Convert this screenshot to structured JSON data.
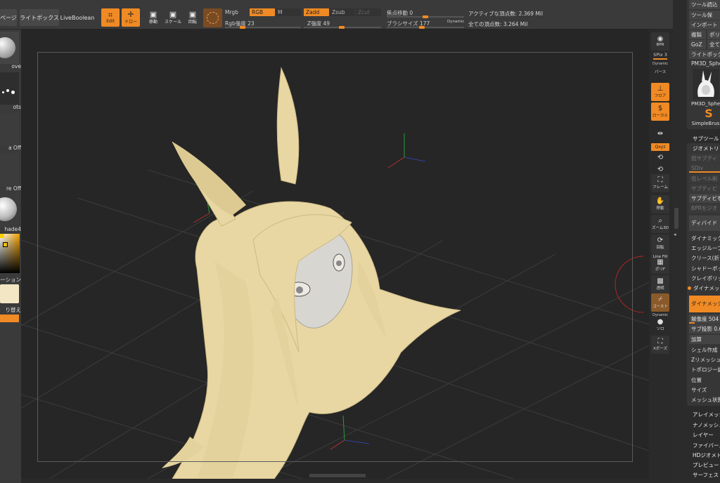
{
  "top_bar": {
    "page_label": "ページ",
    "lightbox_label": "ライトボックス",
    "liveboolean_label": "LiveBoolean",
    "edit_label": "Edit",
    "draw_label": "ドロー",
    "move_label": "移動",
    "scale_label": "スケール",
    "rotate_label": "回転",
    "mrgb_label": "Mrgb",
    "rgb_label": "RGB",
    "m_label": "M",
    "rgb_intensity_label": "Rgb強度",
    "rgb_intensity_value": "23",
    "zadd_label": "Zadd",
    "zsub_label": "Zsub",
    "zcut_label": "Zcut",
    "z_intensity_label": "Z強度",
    "z_intensity_value": "49",
    "focal_shift_label": "焦点移動",
    "focal_shift_value": "0",
    "brush_size_label": "ブラシサイズ",
    "brush_size_value": "177",
    "dynamic_label": "Dynamic",
    "active_points": "アクティブな頂点数: 2.369 Mil",
    "total_points": "全ての頂点数: 3.264 Mil",
    "rgb_intensity_level": 0.23,
    "z_intensity_level": 0.49,
    "focal_level": 0.5,
    "brush_level": 0.45
  },
  "left_tray": {
    "brush_label": "ove",
    "stroke_label": "ots",
    "alpha_label": "a Off",
    "texture_label": "re Off",
    "material_label": "hade4",
    "gradient_label": "ーション",
    "swap_label": "り替え"
  },
  "right_shelf": {
    "bpr_label": "BPR",
    "spix_label": "SPix 3",
    "dynamic_label": "Dynamic",
    "persp_label": "パース",
    "floor_label": "フロア",
    "local_label": "ローカル",
    "xyz_label": "Qxyz",
    "frame_label": "フレーム",
    "move_label": "移動",
    "zoom_label": "ズーム3D",
    "rotate_label": "回転",
    "linefill_label": "Line Fill",
    "polyf_label": "ポリF",
    "transp_label": "透明",
    "ghost_label": "ゴースト",
    "dynamic2_label": "Dynamic",
    "solo_label": "ソロ",
    "xpose_label": "Xポーズ"
  },
  "right_panel": {
    "tool_load": "ツール読込",
    "tool_save": "ツール保",
    "import": "インポート",
    "clone": "複製",
    "poly": "ポリ",
    "goz": "GoZ",
    "all": "全て",
    "lightbox_tools": "ライトボック",
    "tool_name": "PM3D_Sphe",
    "thumb_name": "PM3D_Spher",
    "simple_brush": "SimpleBrus",
    "subtool": "サブツール",
    "geometry": "ジオメトリ",
    "higher_subdiv": "低サブディ",
    "sdiv": "SDiv",
    "lower_res": "低レベル削",
    "subdiv_del": "サブディビ",
    "subdiv_freeze": "サブディビを",
    "bpr_geo": "BPRをジオ",
    "divide": "ディバイド",
    "dynamic_subdiv": "ダイナミック",
    "edge_loop": "エッジループ",
    "crease": "クリース(折",
    "shadowbox": "シャドーボッ",
    "claypolish": "クレイポリッ",
    "dynamesh": "ダイナメッシ",
    "dynamesh_btn": "ダイナメッシ",
    "resolution_label": "解像度",
    "resolution_value": "504",
    "subproj": "サブ投影 0.6",
    "add": "加算",
    "shell": "シェル作成",
    "zremesher": "Zリメッシュ",
    "topology": "トポロジー調",
    "position": "位置",
    "size": "サイズ",
    "mesh_integrity": "メッシュ状態",
    "array_mesh": "アレイメッシ",
    "nano_mesh": "ナノメッシュ",
    "layers": "レイヤー",
    "fibermesh": "ファイバーメ",
    "hd_geometry": "HDジオメト",
    "preview": "プレビュー",
    "surface": "サーフェス"
  },
  "colors": {
    "accent": "#f08a24",
    "panel": "#3a3a3a",
    "canvas": "#262626",
    "clay": "#ead9a6",
    "skin": "#d9d7d2"
  }
}
